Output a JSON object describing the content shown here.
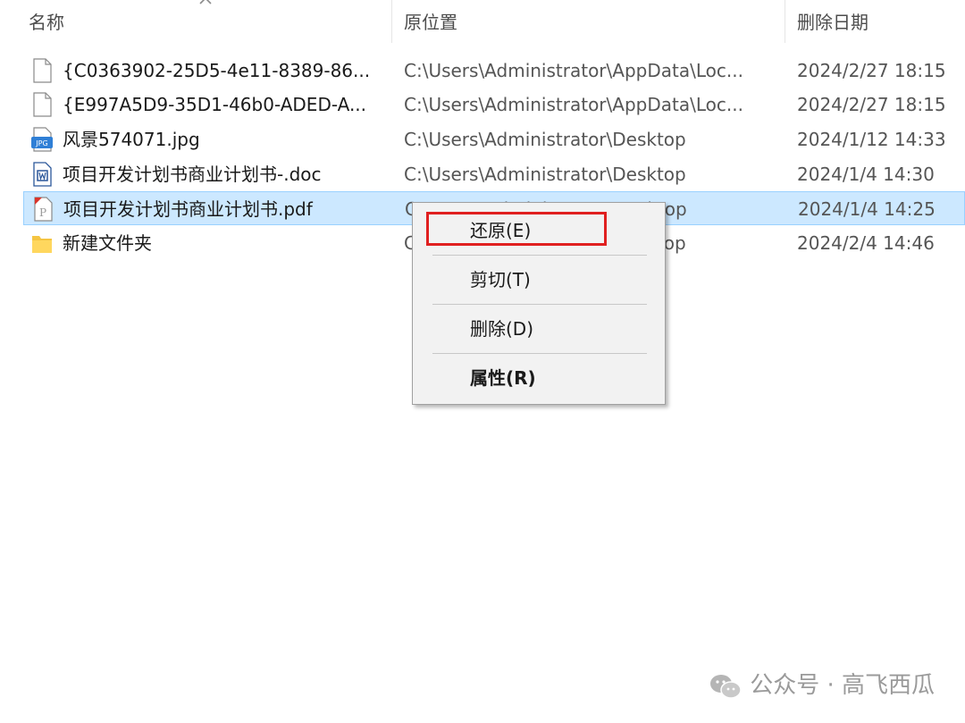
{
  "columns": {
    "name": "名称",
    "location": "原位置",
    "deleted_date": "删除日期"
  },
  "files": [
    {
      "icon": "blank-file-icon",
      "name": "{C0363902-25D5-4e11-8389-86...",
      "location": "C:\\Users\\Administrator\\AppData\\Loc...",
      "date": "2024/2/27 18:15"
    },
    {
      "icon": "blank-file-icon",
      "name": "{E997A5D9-35D1-46b0-ADED-A...",
      "location": "C:\\Users\\Administrator\\AppData\\Loc...",
      "date": "2024/2/27 18:15"
    },
    {
      "icon": "jpg-file-icon",
      "name": "风景574071.jpg",
      "location": "C:\\Users\\Administrator\\Desktop",
      "date": "2024/1/12 14:33"
    },
    {
      "icon": "doc-file-icon",
      "name": "项目开发计划书商业计划书-.doc",
      "location": "C:\\Users\\Administrator\\Desktop",
      "date": "2024/1/4 14:30"
    },
    {
      "icon": "pdf-file-icon",
      "name": "项目开发计划书商业计划书.pdf",
      "location": "C:\\Users\\Administrator\\Desktop",
      "date": "2024/1/4 14:25",
      "selected": true
    },
    {
      "icon": "folder-icon",
      "name": "新建文件夹",
      "location": "C:\\Users\\Administrator\\Desktop",
      "date": "2024/2/4 14:46"
    }
  ],
  "context_menu": {
    "restore": "还原(E)",
    "cut": "剪切(T)",
    "delete": "删除(D)",
    "properties": "属性(R)"
  },
  "watermark": "公众号 · 高飞西瓜",
  "colors": {
    "selection_bg": "#cce8ff",
    "selection_border": "#99d1ff",
    "highlight_red": "#e02020"
  }
}
